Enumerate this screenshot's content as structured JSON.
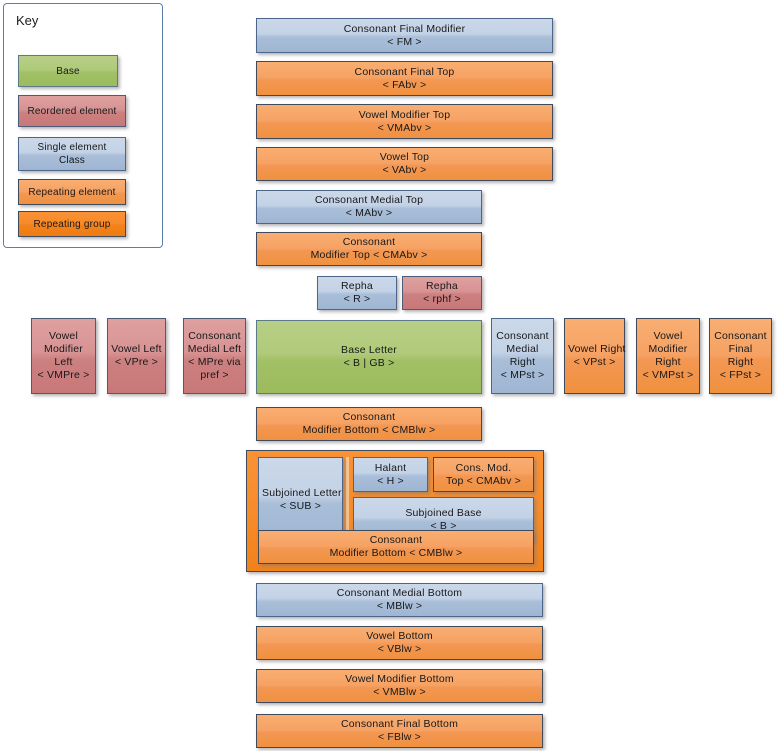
{
  "key": {
    "title": "Key",
    "items": [
      {
        "name": "base",
        "label": "Base",
        "sublabel": "",
        "style": "green"
      },
      {
        "name": "reordered-element",
        "label": "Reordered element",
        "sublabel": "",
        "style": "red"
      },
      {
        "name": "single-element",
        "label": "Single element",
        "sublabel": "Class",
        "style": "blue"
      },
      {
        "name": "repeating-element",
        "label": "Repeating element",
        "sublabel": "",
        "style": "orange"
      },
      {
        "name": "repeating-group",
        "label": "Repeating group",
        "sublabel": "",
        "style": "orange-strong"
      }
    ]
  },
  "colors": {
    "base_green": "#a2c066",
    "reordered_red": "#cd8080",
    "single_blue": "#a9bed8",
    "repeating_orange": "#f39753",
    "repeating_group_orange": "#f4821c",
    "border_blue": "#4d6589",
    "panel_border": "#5a7fa6"
  },
  "top_stack": [
    {
      "name": "consonant-final-modifier",
      "l1": "Consonant Final Modifier",
      "l2": "< FM >",
      "style": "blue"
    },
    {
      "name": "consonant-final-top",
      "l1": "Consonant Final Top",
      "l2": "< FAbv >",
      "style": "orange"
    },
    {
      "name": "vowel-modifier-top",
      "l1": "Vowel Modifier Top",
      "l2": "< VMAbv >",
      "style": "orange"
    },
    {
      "name": "vowel-top",
      "l1": "Vowel Top",
      "l2": "< VAbv >",
      "style": "orange"
    },
    {
      "name": "consonant-medial-top",
      "l1": "Consonant Medial Top",
      "l2": "< MAbv >",
      "style": "blue"
    },
    {
      "name": "consonant-modifier-top",
      "l1": "Consonant",
      "l2": "Modifier Top < CMAbv >",
      "style": "orange"
    }
  ],
  "repha_row": [
    {
      "name": "repha-r",
      "l1": "Repha",
      "l2": "< R >",
      "style": "blue"
    },
    {
      "name": "repha-rphf",
      "l1": "Repha",
      "l2": "< rphf >",
      "style": "red"
    }
  ],
  "base_row": {
    "left": [
      {
        "name": "vowel-modifier-left",
        "lines": [
          "Vowel",
          "Modifier",
          "Left",
          "< VMPre >"
        ],
        "style": "red"
      },
      {
        "name": "vowel-left",
        "lines": [
          "Vowel Left",
          "< VPre >"
        ],
        "style": "red"
      },
      {
        "name": "consonant-medial-left",
        "lines": [
          "Consonant",
          "Medial Left",
          "< MPre via",
          "pref >"
        ],
        "style": "red"
      }
    ],
    "center": {
      "name": "base-letter",
      "l1": "Base Letter",
      "l2": "< B | GB >",
      "style": "green"
    },
    "right": [
      {
        "name": "consonant-medial-right",
        "lines": [
          "Consonant",
          "Medial",
          "Right",
          "< MPst >"
        ],
        "style": "blue"
      },
      {
        "name": "vowel-right",
        "lines": [
          "Vowel Right",
          "< VPst >"
        ],
        "style": "orange"
      },
      {
        "name": "vowel-modifier-right",
        "lines": [
          "Vowel",
          "Modifier",
          "Right",
          "< VMPst >"
        ],
        "style": "orange"
      },
      {
        "name": "consonant-final-right",
        "lines": [
          "Consonant",
          "Final",
          "Right",
          "< FPst >"
        ],
        "style": "orange"
      }
    ]
  },
  "cmblw_above_group": {
    "name": "consonant-modifier-bottom-above",
    "l1": "Consonant",
    "l2": "Modifier Bottom < CMBlw >",
    "style": "orange"
  },
  "subjoined_group": {
    "name": "subjoined-repeating-group",
    "subjoined_letter": {
      "name": "subjoined-letter",
      "l1": "Subjoined Letter",
      "l2": "< SUB >",
      "style": "blue"
    },
    "halant": {
      "name": "halant",
      "l1": "Halant",
      "l2": "< H >",
      "style": "blue"
    },
    "cons_mod_top": {
      "name": "cons-mod-top",
      "l1": "Cons. Mod.",
      "l2": "Top < CMAbv >",
      "style": "orange"
    },
    "subjoined_base": {
      "name": "subjoined-base",
      "l1": "Subjoined Base",
      "l2": "< B >",
      "style": "blue"
    },
    "cons_mod_bottom": {
      "name": "consonant-modifier-bottom-inner",
      "l1": "Consonant",
      "l2": "Modifier Bottom < CMBlw >",
      "style": "orange"
    }
  },
  "bottom_stack": [
    {
      "name": "consonant-medial-bottom",
      "l1": "Consonant Medial Bottom",
      "l2": "< MBlw >",
      "style": "blue"
    },
    {
      "name": "vowel-bottom",
      "l1": "Vowel Bottom",
      "l2": "< VBlw >",
      "style": "orange"
    },
    {
      "name": "vowel-modifier-bottom",
      "l1": "Vowel Modifier Bottom",
      "l2": "< VMBlw >",
      "style": "orange"
    },
    {
      "name": "consonant-final-bottom",
      "l1": "Consonant Final Bottom",
      "l2": "< FBlw >",
      "style": "orange"
    }
  ]
}
